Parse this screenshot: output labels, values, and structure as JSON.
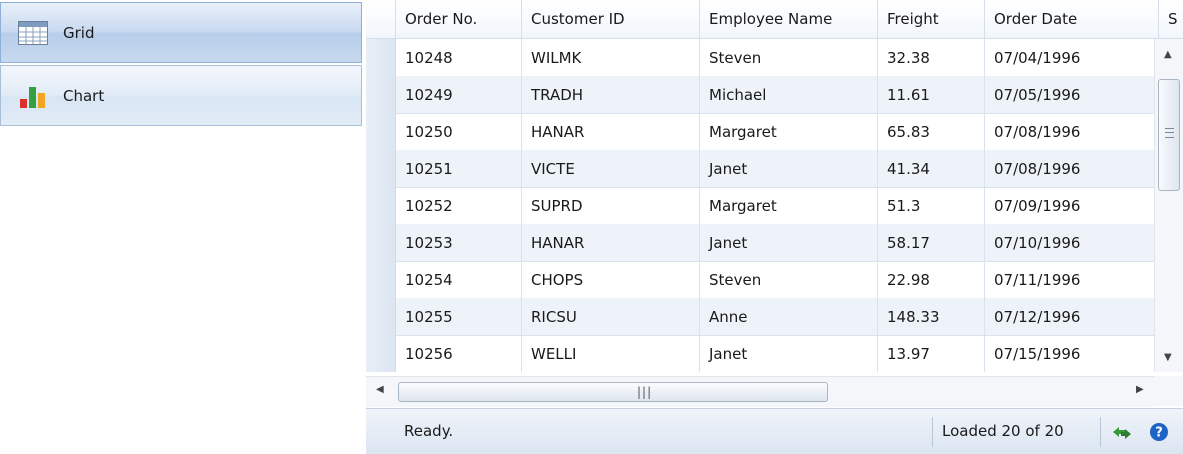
{
  "nav": {
    "items": [
      {
        "label": "Grid",
        "icon": "grid-icon"
      },
      {
        "label": "Chart",
        "icon": "chart-icon"
      }
    ]
  },
  "grid": {
    "columns": [
      "Order No.",
      "Customer ID",
      "Employee Name",
      "Freight",
      "Order Date",
      "S"
    ],
    "rows": [
      [
        "10248",
        "WILMK",
        "Steven",
        "32.38",
        "07/04/1996"
      ],
      [
        "10249",
        "TRADH",
        "Michael",
        "11.61",
        "07/05/1996"
      ],
      [
        "10250",
        "HANAR",
        "Margaret",
        "65.83",
        "07/08/1996"
      ],
      [
        "10251",
        "VICTE",
        "Janet",
        "41.34",
        "07/08/1996"
      ],
      [
        "10252",
        "SUPRD",
        "Margaret",
        "51.3",
        "07/09/1996"
      ],
      [
        "10253",
        "HANAR",
        "Janet",
        "58.17",
        "07/10/1996"
      ],
      [
        "10254",
        "CHOPS",
        "Steven",
        "22.98",
        "07/11/1996"
      ],
      [
        "10255",
        "RICSU",
        "Anne",
        "148.33",
        "07/12/1996"
      ],
      [
        "10256",
        "WELLI",
        "Janet",
        "13.97",
        "07/15/1996"
      ]
    ]
  },
  "status": {
    "text": "Ready.",
    "loaded": "Loaded 20 of 20",
    "refresh_icon": "refresh-icon",
    "help_icon": "help-icon"
  },
  "colors": {
    "accent": "#2e7d32",
    "help": "#1e63c6"
  }
}
